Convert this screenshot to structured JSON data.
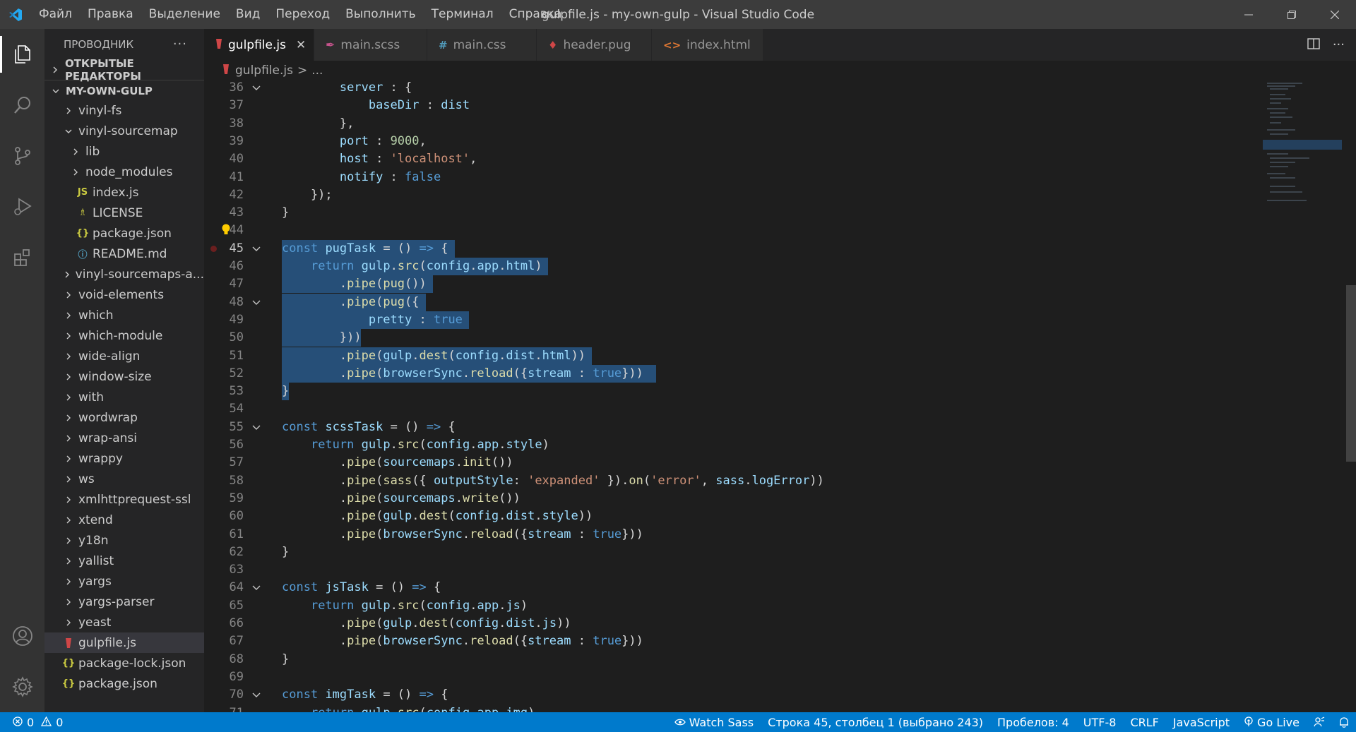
{
  "menu": [
    "Файл",
    "Правка",
    "Выделение",
    "Вид",
    "Переход",
    "Выполнить",
    "Терминал",
    "Справка"
  ],
  "window_title": "gulpfile.js - my-own-gulp - Visual Studio Code",
  "explorer": {
    "title": "ПРОВОДНИК",
    "open_editors": "ОТКРЫТЫЕ РЕДАКТОРЫ",
    "project": "MY-OWN-GULP",
    "tree": [
      {
        "label": "vinyl-fs",
        "indent": 1,
        "kind": "folder",
        "expanded": false
      },
      {
        "label": "vinyl-sourcemap",
        "indent": 1,
        "kind": "folder",
        "expanded": true
      },
      {
        "label": "lib",
        "indent": 2,
        "kind": "folder",
        "expanded": false
      },
      {
        "label": "node_modules",
        "indent": 2,
        "kind": "folder",
        "expanded": false
      },
      {
        "label": "index.js",
        "indent": 2,
        "kind": "js"
      },
      {
        "label": "LICENSE",
        "indent": 2,
        "kind": "license"
      },
      {
        "label": "package.json",
        "indent": 2,
        "kind": "json"
      },
      {
        "label": "README.md",
        "indent": 2,
        "kind": "info"
      },
      {
        "label": "vinyl-sourcemaps-a...",
        "indent": 1,
        "kind": "folder",
        "expanded": false
      },
      {
        "label": "void-elements",
        "indent": 1,
        "kind": "folder",
        "expanded": false
      },
      {
        "label": "which",
        "indent": 1,
        "kind": "folder",
        "expanded": false
      },
      {
        "label": "which-module",
        "indent": 1,
        "kind": "folder",
        "expanded": false
      },
      {
        "label": "wide-align",
        "indent": 1,
        "kind": "folder",
        "expanded": false
      },
      {
        "label": "window-size",
        "indent": 1,
        "kind": "folder",
        "expanded": false
      },
      {
        "label": "with",
        "indent": 1,
        "kind": "folder",
        "expanded": false
      },
      {
        "label": "wordwrap",
        "indent": 1,
        "kind": "folder",
        "expanded": false
      },
      {
        "label": "wrap-ansi",
        "indent": 1,
        "kind": "folder",
        "expanded": false
      },
      {
        "label": "wrappy",
        "indent": 1,
        "kind": "folder",
        "expanded": false
      },
      {
        "label": "ws",
        "indent": 1,
        "kind": "folder",
        "expanded": false
      },
      {
        "label": "xmlhttprequest-ssl",
        "indent": 1,
        "kind": "folder",
        "expanded": false
      },
      {
        "label": "xtend",
        "indent": 1,
        "kind": "folder",
        "expanded": false
      },
      {
        "label": "y18n",
        "indent": 1,
        "kind": "folder",
        "expanded": false
      },
      {
        "label": "yallist",
        "indent": 1,
        "kind": "folder",
        "expanded": false
      },
      {
        "label": "yargs",
        "indent": 1,
        "kind": "folder",
        "expanded": false
      },
      {
        "label": "yargs-parser",
        "indent": 1,
        "kind": "folder",
        "expanded": false
      },
      {
        "label": "yeast",
        "indent": 1,
        "kind": "folder",
        "expanded": false
      },
      {
        "label": "gulpfile.js",
        "indent": 0,
        "kind": "gulp",
        "selected": true
      },
      {
        "label": "package-lock.json",
        "indent": 0,
        "kind": "json"
      },
      {
        "label": "package.json",
        "indent": 0,
        "kind": "json"
      }
    ]
  },
  "tabs": [
    {
      "label": "gulpfile.js",
      "icon": "gulp-icon",
      "active": true
    },
    {
      "label": "main.scss",
      "icon": "sass-icon",
      "active": false
    },
    {
      "label": "main.css",
      "icon": "hash-icon",
      "active": false
    },
    {
      "label": "header.pug",
      "icon": "pug-icon",
      "active": false
    },
    {
      "label": "index.html",
      "icon": "html-icon",
      "active": false
    }
  ],
  "breadcrumb": {
    "file": "gulpfile.js",
    "sep": ">",
    "more": "..."
  },
  "code_lines": [
    {
      "n": 36,
      "fold": true,
      "toks": [
        [
          "w",
          "        "
        ],
        [
          "v",
          "server"
        ],
        [
          "w",
          " : {"
        ]
      ]
    },
    {
      "n": 37,
      "toks": [
        [
          "w",
          "            "
        ],
        [
          "v",
          "baseDir"
        ],
        [
          "w",
          " : "
        ],
        [
          "v",
          "dist"
        ]
      ]
    },
    {
      "n": 38,
      "toks": [
        [
          "w",
          "        },"
        ]
      ]
    },
    {
      "n": 39,
      "toks": [
        [
          "w",
          "        "
        ],
        [
          "v",
          "port"
        ],
        [
          "w",
          " : "
        ],
        [
          "n",
          "9000"
        ],
        [
          "w",
          ","
        ]
      ]
    },
    {
      "n": 40,
      "toks": [
        [
          "w",
          "        "
        ],
        [
          "v",
          "host"
        ],
        [
          "w",
          " : "
        ],
        [
          "s",
          "'localhost'"
        ],
        [
          "w",
          ","
        ]
      ]
    },
    {
      "n": 41,
      "toks": [
        [
          "w",
          "        "
        ],
        [
          "v",
          "notify"
        ],
        [
          "w",
          " : "
        ],
        [
          "k",
          "false"
        ]
      ]
    },
    {
      "n": 42,
      "toks": [
        [
          "w",
          "    });"
        ]
      ]
    },
    {
      "n": 43,
      "toks": [
        [
          "w",
          "}"
        ]
      ]
    },
    {
      "n": 44,
      "bulb": true,
      "toks": []
    },
    {
      "n": 45,
      "fold": true,
      "bp": true,
      "cur": true,
      "sel": 24,
      "toks": [
        [
          "k",
          "const"
        ],
        [
          "w",
          " "
        ],
        [
          "v",
          "pugTask"
        ],
        [
          "w",
          " = () "
        ],
        [
          "k",
          "=>"
        ],
        [
          "w",
          " {"
        ]
      ]
    },
    {
      "n": 46,
      "sel": 37,
      "toks": [
        [
          "w",
          "    "
        ],
        [
          "k",
          "return"
        ],
        [
          "w",
          " "
        ],
        [
          "v",
          "gulp"
        ],
        [
          "w",
          "."
        ],
        [
          "f",
          "src"
        ],
        [
          "w",
          "("
        ],
        [
          "v",
          "config"
        ],
        [
          "w",
          "."
        ],
        [
          "v",
          "app"
        ],
        [
          "w",
          "."
        ],
        [
          "v",
          "html"
        ],
        [
          "w",
          ")"
        ]
      ]
    },
    {
      "n": 47,
      "sel": 21,
      "toks": [
        [
          "w",
          "        ."
        ],
        [
          "f",
          "pipe"
        ],
        [
          "w",
          "("
        ],
        [
          "f",
          "pug"
        ],
        [
          "w",
          "())"
        ]
      ]
    },
    {
      "n": 48,
      "fold": true,
      "sel": 20,
      "toks": [
        [
          "w",
          "        ."
        ],
        [
          "f",
          "pipe"
        ],
        [
          "w",
          "("
        ],
        [
          "f",
          "pug"
        ],
        [
          "w",
          "({"
        ]
      ]
    },
    {
      "n": 49,
      "sel": 26,
      "toks": [
        [
          "w",
          "            "
        ],
        [
          "v",
          "pretty"
        ],
        [
          "w",
          " : "
        ],
        [
          "k",
          "true"
        ]
      ]
    },
    {
      "n": 50,
      "sel": 11,
      "toks": [
        [
          "w",
          "        }))"
        ]
      ]
    },
    {
      "n": 51,
      "sel": 43,
      "toks": [
        [
          "w",
          "        ."
        ],
        [
          "f",
          "pipe"
        ],
        [
          "w",
          "("
        ],
        [
          "v",
          "gulp"
        ],
        [
          "w",
          "."
        ],
        [
          "f",
          "dest"
        ],
        [
          "w",
          "("
        ],
        [
          "v",
          "config"
        ],
        [
          "w",
          "."
        ],
        [
          "v",
          "dist"
        ],
        [
          "w",
          "."
        ],
        [
          "v",
          "html"
        ],
        [
          "w",
          "))"
        ]
      ]
    },
    {
      "n": 52,
      "sel": 52,
      "toks": [
        [
          "w",
          "        ."
        ],
        [
          "f",
          "pipe"
        ],
        [
          "w",
          "("
        ],
        [
          "v",
          "browserSync"
        ],
        [
          "w",
          "."
        ],
        [
          "f",
          "reload"
        ],
        [
          "w",
          "({"
        ],
        [
          "v",
          "stream"
        ],
        [
          "w",
          " : "
        ],
        [
          "k",
          "true"
        ],
        [
          "w",
          "}))"
        ]
      ]
    },
    {
      "n": 53,
      "sel": 1,
      "toks": [
        [
          "w",
          "}"
        ]
      ]
    },
    {
      "n": 54,
      "toks": []
    },
    {
      "n": 55,
      "fold": true,
      "toks": [
        [
          "k",
          "const"
        ],
        [
          "w",
          " "
        ],
        [
          "v",
          "scssTask"
        ],
        [
          "w",
          " = () "
        ],
        [
          "k",
          "=>"
        ],
        [
          "w",
          " {"
        ]
      ]
    },
    {
      "n": 56,
      "toks": [
        [
          "w",
          "    "
        ],
        [
          "k",
          "return"
        ],
        [
          "w",
          " "
        ],
        [
          "v",
          "gulp"
        ],
        [
          "w",
          "."
        ],
        [
          "f",
          "src"
        ],
        [
          "w",
          "("
        ],
        [
          "v",
          "config"
        ],
        [
          "w",
          "."
        ],
        [
          "v",
          "app"
        ],
        [
          "w",
          "."
        ],
        [
          "v",
          "style"
        ],
        [
          "w",
          ")"
        ]
      ]
    },
    {
      "n": 57,
      "toks": [
        [
          "w",
          "        ."
        ],
        [
          "f",
          "pipe"
        ],
        [
          "w",
          "("
        ],
        [
          "v",
          "sourcemaps"
        ],
        [
          "w",
          "."
        ],
        [
          "f",
          "init"
        ],
        [
          "w",
          "())"
        ]
      ]
    },
    {
      "n": 58,
      "toks": [
        [
          "w",
          "        ."
        ],
        [
          "f",
          "pipe"
        ],
        [
          "w",
          "("
        ],
        [
          "f",
          "sass"
        ],
        [
          "w",
          "({ "
        ],
        [
          "v",
          "outputStyle"
        ],
        [
          "w",
          ": "
        ],
        [
          "s",
          "'expanded'"
        ],
        [
          "w",
          " })."
        ],
        [
          "f",
          "on"
        ],
        [
          "w",
          "("
        ],
        [
          "s",
          "'error'"
        ],
        [
          "w",
          ", "
        ],
        [
          "v",
          "sass"
        ],
        [
          "w",
          "."
        ],
        [
          "v",
          "logError"
        ],
        [
          "w",
          "))"
        ]
      ]
    },
    {
      "n": 59,
      "toks": [
        [
          "w",
          "        ."
        ],
        [
          "f",
          "pipe"
        ],
        [
          "w",
          "("
        ],
        [
          "v",
          "sourcemaps"
        ],
        [
          "w",
          "."
        ],
        [
          "f",
          "write"
        ],
        [
          "w",
          "())"
        ]
      ]
    },
    {
      "n": 60,
      "toks": [
        [
          "w",
          "        ."
        ],
        [
          "f",
          "pipe"
        ],
        [
          "w",
          "("
        ],
        [
          "v",
          "gulp"
        ],
        [
          "w",
          "."
        ],
        [
          "f",
          "dest"
        ],
        [
          "w",
          "("
        ],
        [
          "v",
          "config"
        ],
        [
          "w",
          "."
        ],
        [
          "v",
          "dist"
        ],
        [
          "w",
          "."
        ],
        [
          "v",
          "style"
        ],
        [
          "w",
          "))"
        ]
      ]
    },
    {
      "n": 61,
      "toks": [
        [
          "w",
          "        ."
        ],
        [
          "f",
          "pipe"
        ],
        [
          "w",
          "("
        ],
        [
          "v",
          "browserSync"
        ],
        [
          "w",
          "."
        ],
        [
          "f",
          "reload"
        ],
        [
          "w",
          "({"
        ],
        [
          "v",
          "stream"
        ],
        [
          "w",
          " : "
        ],
        [
          "k",
          "true"
        ],
        [
          "w",
          "}))"
        ]
      ]
    },
    {
      "n": 62,
      "toks": [
        [
          "w",
          "}"
        ]
      ]
    },
    {
      "n": 63,
      "toks": []
    },
    {
      "n": 64,
      "fold": true,
      "toks": [
        [
          "k",
          "const"
        ],
        [
          "w",
          " "
        ],
        [
          "v",
          "jsTask"
        ],
        [
          "w",
          " = () "
        ],
        [
          "k",
          "=>"
        ],
        [
          "w",
          " {"
        ]
      ]
    },
    {
      "n": 65,
      "toks": [
        [
          "w",
          "    "
        ],
        [
          "k",
          "return"
        ],
        [
          "w",
          " "
        ],
        [
          "v",
          "gulp"
        ],
        [
          "w",
          "."
        ],
        [
          "f",
          "src"
        ],
        [
          "w",
          "("
        ],
        [
          "v",
          "config"
        ],
        [
          "w",
          "."
        ],
        [
          "v",
          "app"
        ],
        [
          "w",
          "."
        ],
        [
          "v",
          "js"
        ],
        [
          "w",
          ")"
        ]
      ]
    },
    {
      "n": 66,
      "toks": [
        [
          "w",
          "        ."
        ],
        [
          "f",
          "pipe"
        ],
        [
          "w",
          "("
        ],
        [
          "v",
          "gulp"
        ],
        [
          "w",
          "."
        ],
        [
          "f",
          "dest"
        ],
        [
          "w",
          "("
        ],
        [
          "v",
          "config"
        ],
        [
          "w",
          "."
        ],
        [
          "v",
          "dist"
        ],
        [
          "w",
          "."
        ],
        [
          "v",
          "js"
        ],
        [
          "w",
          "))"
        ]
      ]
    },
    {
      "n": 67,
      "toks": [
        [
          "w",
          "        ."
        ],
        [
          "f",
          "pipe"
        ],
        [
          "w",
          "("
        ],
        [
          "v",
          "browserSync"
        ],
        [
          "w",
          "."
        ],
        [
          "f",
          "reload"
        ],
        [
          "w",
          "({"
        ],
        [
          "v",
          "stream"
        ],
        [
          "w",
          " : "
        ],
        [
          "k",
          "true"
        ],
        [
          "w",
          "}))"
        ]
      ]
    },
    {
      "n": 68,
      "toks": [
        [
          "w",
          "}"
        ]
      ]
    },
    {
      "n": 69,
      "toks": []
    },
    {
      "n": 70,
      "fold": true,
      "toks": [
        [
          "k",
          "const"
        ],
        [
          "w",
          " "
        ],
        [
          "v",
          "imgTask"
        ],
        [
          "w",
          " = () "
        ],
        [
          "k",
          "=>"
        ],
        [
          "w",
          " {"
        ]
      ]
    },
    {
      "n": 71,
      "toks": [
        [
          "w",
          "    "
        ],
        [
          "k",
          "return"
        ],
        [
          "w",
          " "
        ],
        [
          "v",
          "gulp"
        ],
        [
          "w",
          "."
        ],
        [
          "f",
          "src"
        ],
        [
          "w",
          "("
        ],
        [
          "v",
          "config"
        ],
        [
          "w",
          "."
        ],
        [
          "v",
          "app"
        ],
        [
          "w",
          "."
        ],
        [
          "v",
          "img"
        ],
        [
          "w",
          ")"
        ]
      ]
    }
  ],
  "status": {
    "errors": "0",
    "warnings": "0",
    "watch_sass": "Watch Sass",
    "position": "Строка 45, столбец 1 (выбрано 243)",
    "spaces": "Пробелов: 4",
    "encoding": "UTF-8",
    "eol": "CRLF",
    "language": "JavaScript",
    "go_live": "Go Live"
  },
  "colors": {
    "accent": "#007acc",
    "selection": "#264f78",
    "keyword": "#569cd6",
    "function": "#dcdcaa",
    "variable": "#9cdcfe",
    "string": "#ce9178",
    "number": "#b5cea8"
  }
}
